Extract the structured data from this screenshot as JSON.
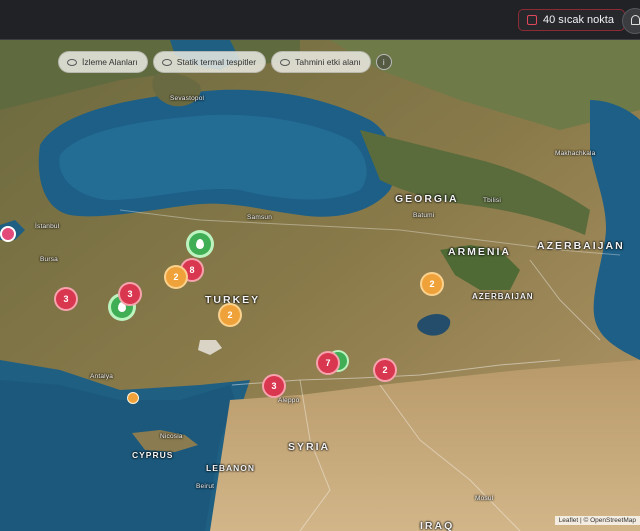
{
  "topbar": {
    "hotspot_button": "40 sıcak nokta",
    "hotspot_icon": "alert-square-icon",
    "bell_icon": "bell-icon"
  },
  "filters": [
    {
      "label": "İzleme Alanları",
      "icon": "eye-icon"
    },
    {
      "label": "Statik termal tespitler",
      "icon": "eye-icon"
    },
    {
      "label": "Tahmini etki alanı",
      "icon": "eye-off-icon"
    }
  ],
  "info_symbol": "i",
  "map_labels": {
    "turkey": "TURKEY",
    "georgia": "GEORGIA",
    "armenia": "ARMENIA",
    "azerbaijan": "AZERBAIJAN",
    "azerbaijan_exclave": "AZERBAIJAN",
    "syria": "SYRIA",
    "lebanon": "LEBANON",
    "cyprus": "CYPRUS",
    "iraq": "IRAQ",
    "istanbul": "İstanbul",
    "samsun": "Samsun",
    "bursa": "Bursa",
    "antalya": "Antalya",
    "aleppo": "Aleppo",
    "beirut": "Beirut",
    "batumi": "Batumi",
    "tbilisi": "Tbilisi",
    "sevastopol": "Sevastopol",
    "makhachkala": "Makhachkala",
    "nicosia": "Nicosia",
    "mosul": "Mosul"
  },
  "clusters": [
    {
      "kind": "red",
      "count": "3"
    },
    {
      "kind": "red",
      "count": "3"
    },
    {
      "kind": "red",
      "count": "8"
    },
    {
      "kind": "orange",
      "count": "2"
    },
    {
      "kind": "orange",
      "count": "2"
    },
    {
      "kind": "orange",
      "count": "2"
    },
    {
      "kind": "red",
      "count": "7"
    },
    {
      "kind": "red",
      "count": "2"
    },
    {
      "kind": "red",
      "count": "3"
    }
  ],
  "attribution": "Leaflet | © OpenStreetMap"
}
